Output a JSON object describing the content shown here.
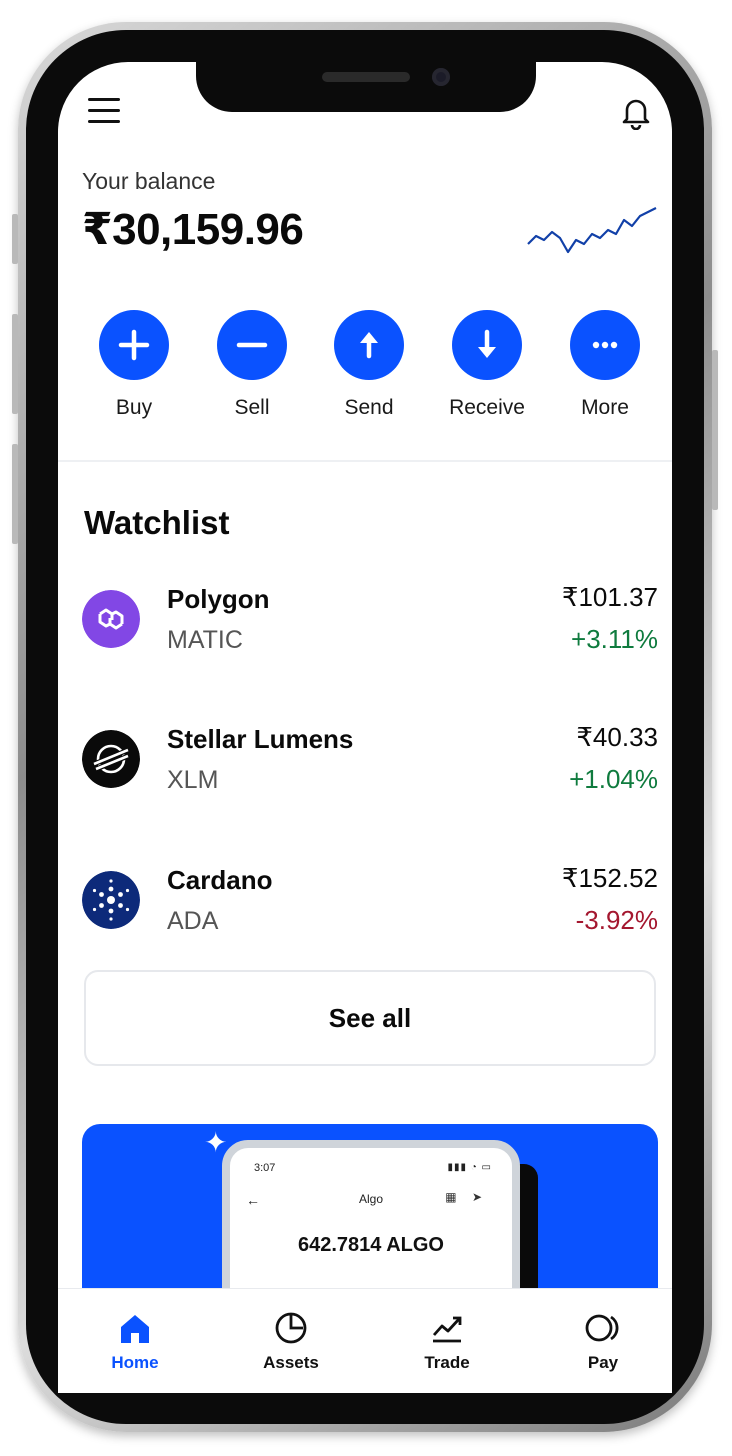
{
  "balance": {
    "label": "Your balance",
    "value": "₹30,159.96"
  },
  "actions": [
    {
      "label": "Buy",
      "icon": "plus-icon"
    },
    {
      "label": "Sell",
      "icon": "minus-icon"
    },
    {
      "label": "Send",
      "icon": "arrow-up-icon"
    },
    {
      "label": "Receive",
      "icon": "arrow-down-icon"
    },
    {
      "label": "More",
      "icon": "more-dots-icon"
    }
  ],
  "watchlist": {
    "title": "Watchlist",
    "items": [
      {
        "name": "Polygon",
        "symbol": "MATIC",
        "price": "₹101.37",
        "change": "+3.11%",
        "direction": "up",
        "logo_color": "#8247e5"
      },
      {
        "name": "Stellar Lumens",
        "symbol": "XLM",
        "price": "₹40.33",
        "change": "+1.04%",
        "direction": "up",
        "logo_color": "#0a0a0a"
      },
      {
        "name": "Cardano",
        "symbol": "ADA",
        "price": "₹152.52",
        "change": "-3.92%",
        "direction": "down",
        "logo_color": "#0d2a7a"
      }
    ],
    "see_all": "See all"
  },
  "promo": {
    "time": "3:07",
    "screen_title": "Algo",
    "amount": "642.7814 ALGO"
  },
  "nav": [
    {
      "label": "Home",
      "icon": "home-icon",
      "active": true
    },
    {
      "label": "Assets",
      "icon": "pie-chart-icon",
      "active": false
    },
    {
      "label": "Trade",
      "icon": "trend-up-icon",
      "active": false
    },
    {
      "label": "Pay",
      "icon": "pay-icon",
      "active": false
    }
  ],
  "colors": {
    "accent": "#0a52ff",
    "positive": "#0f7b3e",
    "negative": "#a4172f"
  }
}
